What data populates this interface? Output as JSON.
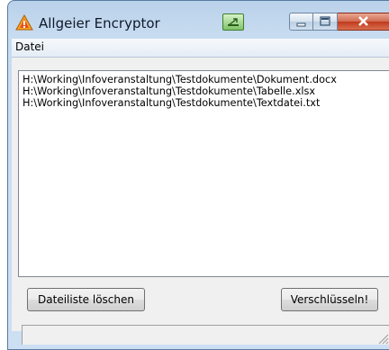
{
  "window": {
    "title": "Allgeier Encryptor",
    "app_icon": "warning-hazard-icon"
  },
  "titlebar_buttons": {
    "minimize_icon": "minimize-icon",
    "maximize_icon": "maximize-icon",
    "close_icon": "close-icon",
    "extra_icon": "window-resize-icon"
  },
  "menu": {
    "items": [
      "Datei"
    ]
  },
  "file_list": {
    "items": [
      "H:\\Working\\Infoveranstaltung\\Testdokumente\\Dokument.docx",
      "H:\\Working\\Infoveranstaltung\\Testdokumente\\Tabelle.xlsx",
      "H:\\Working\\Infoveranstaltung\\Testdokumente\\Textdatei.txt"
    ]
  },
  "buttons": {
    "clear_label": "Dateiliste löschen",
    "encrypt_label": "Verschlüsseln!"
  },
  "status": {
    "text": ""
  },
  "colors": {
    "close_button": "#c0391c",
    "frame": "#b9d1ea"
  }
}
